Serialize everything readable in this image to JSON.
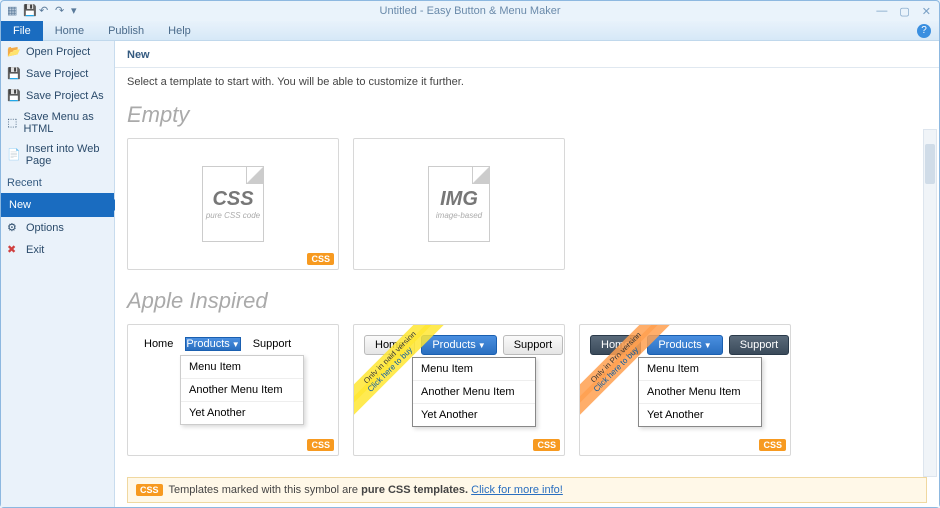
{
  "title": "Untitled - Easy Button & Menu Maker",
  "menubar": {
    "file": "File",
    "home": "Home",
    "publish": "Publish",
    "help": "Help"
  },
  "sidebar": {
    "open": "Open Project",
    "save": "Save Project",
    "saveas": "Save Project As",
    "savehtml": "Save Menu as HTML",
    "insert": "Insert into Web Page",
    "recent": "Recent",
    "new": "New",
    "options": "Options",
    "exit": "Exit"
  },
  "content": {
    "header": "New",
    "sub": "Select a template to start with. You will be able to customize it further.",
    "section_empty": "Empty",
    "section_apple": "Apple Inspired",
    "css_label_big": "CSS",
    "css_label_small": "pure CSS code",
    "img_label_big": "IMG",
    "img_label_small": "image-based",
    "css_badge": "CSS",
    "menu": {
      "home": "Home",
      "products": "Products",
      "support": "Support",
      "item1": "Menu Item",
      "item2": "Another Menu Item",
      "item3": "Yet Another"
    },
    "ribbon_paid": "Only in paid version",
    "ribbon_pro": "Only in Pro version",
    "ribbon_click": "Click here to buy"
  },
  "footer": {
    "text1": "Templates marked with this symbol are ",
    "bold": "pure CSS templates.",
    "link": "Click for more info!"
  }
}
